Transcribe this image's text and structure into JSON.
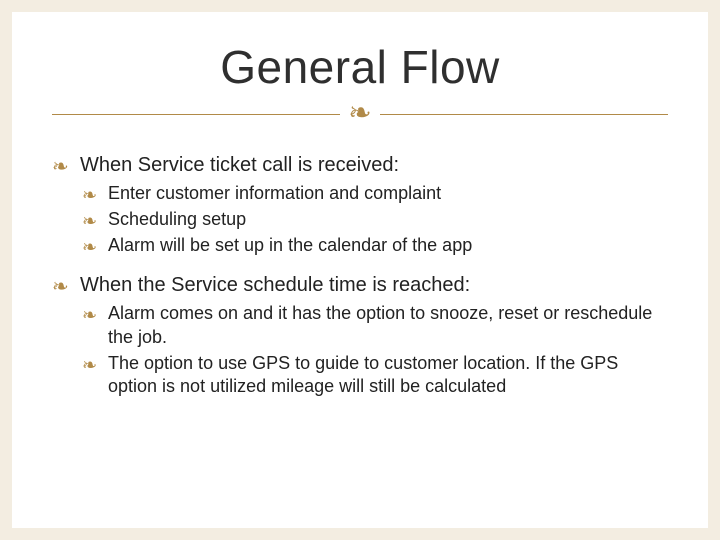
{
  "slide": {
    "title": "General Flow",
    "flourish_glyph": "❧",
    "sections": [
      {
        "heading": "When Service ticket call is received:",
        "items": [
          "Enter customer information and complaint",
          "Scheduling setup",
          "Alarm will be set up in the calendar of the app"
        ]
      },
      {
        "heading": "When the Service schedule time is reached:",
        "items": [
          "Alarm comes on and it has the option to snooze, reset or reschedule the job.",
          "The option to use GPS to guide to customer location. If the GPS option is not utilized mileage will still be calculated"
        ]
      }
    ]
  }
}
